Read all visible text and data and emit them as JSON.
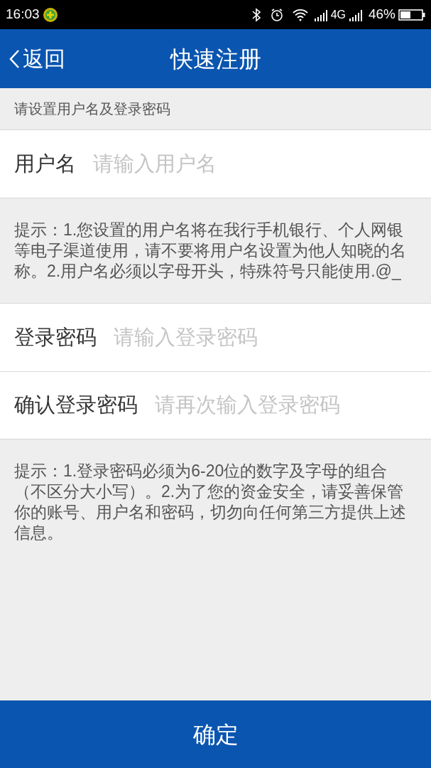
{
  "status_bar": {
    "time": "16:03",
    "network": "4G",
    "battery": "46%"
  },
  "header": {
    "back": "返回",
    "title": "快速注册"
  },
  "section_title": "请设置用户名及登录密码",
  "username_field": {
    "label": "用户名",
    "placeholder": "请输入用户名"
  },
  "username_hint": "提示：1.您设置的用户名将在我行手机银行、个人网银等电子渠道使用，请不要将用户名设置为他人知晓的名称。2.用户名必须以字母开头，特殊符号只能使用.@_",
  "password_fields": [
    {
      "label": "登录密码",
      "placeholder": "请输入登录密码"
    },
    {
      "label": "确认登录密码",
      "placeholder": "请再次输入登录密码"
    }
  ],
  "password_hint": "提示：1.登录密码必须为6-20位的数字及字母的组合（不区分大小写）。2.为了您的资金安全，请妥善保管你的账号、用户名和密码，切勿向任何第三方提供上述信息。",
  "confirm_button": "确定"
}
